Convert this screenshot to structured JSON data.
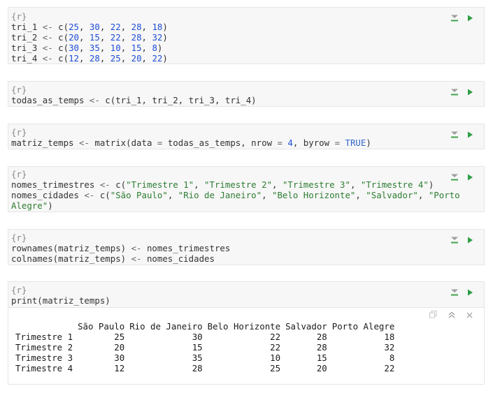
{
  "chunk_header": "{r}",
  "chunks": [
    {
      "lines": [
        [
          [
            "tri_1 ",
            "t"
          ],
          [
            "<- ",
            "op"
          ],
          [
            "c(",
            "t"
          ],
          [
            "25",
            "num"
          ],
          [
            ", ",
            "t"
          ],
          [
            "30",
            "num"
          ],
          [
            ", ",
            "t"
          ],
          [
            "22",
            "num"
          ],
          [
            ", ",
            "t"
          ],
          [
            "28",
            "num"
          ],
          [
            ", ",
            "t"
          ],
          [
            "18",
            "num"
          ],
          [
            ")",
            "t"
          ]
        ],
        [
          [
            "tri_2 ",
            "t"
          ],
          [
            "<- ",
            "op"
          ],
          [
            "c(",
            "t"
          ],
          [
            "20",
            "num"
          ],
          [
            ", ",
            "t"
          ],
          [
            "15",
            "num"
          ],
          [
            ", ",
            "t"
          ],
          [
            "22",
            "num"
          ],
          [
            ", ",
            "t"
          ],
          [
            "28",
            "num"
          ],
          [
            ", ",
            "t"
          ],
          [
            "32",
            "num"
          ],
          [
            ")",
            "t"
          ]
        ],
        [
          [
            "tri_3 ",
            "t"
          ],
          [
            "<- ",
            "op"
          ],
          [
            "c(",
            "t"
          ],
          [
            "30",
            "num"
          ],
          [
            ", ",
            "t"
          ],
          [
            "35",
            "num"
          ],
          [
            ", ",
            "t"
          ],
          [
            "10",
            "num"
          ],
          [
            ", ",
            "t"
          ],
          [
            "15",
            "num"
          ],
          [
            ", ",
            "t"
          ],
          [
            "8",
            "num"
          ],
          [
            ")",
            "t"
          ]
        ],
        [
          [
            "tri_4 ",
            "t"
          ],
          [
            "<- ",
            "op"
          ],
          [
            "c(",
            "t"
          ],
          [
            "12",
            "num"
          ],
          [
            ", ",
            "t"
          ],
          [
            "28",
            "num"
          ],
          [
            ", ",
            "t"
          ],
          [
            "25",
            "num"
          ],
          [
            ", ",
            "t"
          ],
          [
            "20",
            "num"
          ],
          [
            ", ",
            "t"
          ],
          [
            "22",
            "num"
          ],
          [
            ")",
            "t"
          ]
        ]
      ]
    },
    {
      "lines": [
        [
          [
            "todas_as_temps ",
            "t"
          ],
          [
            "<- ",
            "op"
          ],
          [
            "c(tri_1, tri_2, tri_3, tri_4)",
            "t"
          ]
        ]
      ]
    },
    {
      "lines": [
        [
          [
            "matriz_temps ",
            "t"
          ],
          [
            "<- ",
            "op"
          ],
          [
            "matrix(data ",
            "t"
          ],
          [
            "= ",
            "op"
          ],
          [
            "todas_as_temps, nrow ",
            "t"
          ],
          [
            "= ",
            "op"
          ],
          [
            "4",
            "num"
          ],
          [
            ", byrow ",
            "t"
          ],
          [
            "= ",
            "op"
          ],
          [
            "TRUE",
            "kw"
          ],
          [
            ")",
            "t"
          ]
        ]
      ]
    },
    {
      "lines": [
        [
          [
            "nomes_trimestres ",
            "t"
          ],
          [
            "<- ",
            "op"
          ],
          [
            "c(",
            "t"
          ],
          [
            "\"Trimestre 1\"",
            "str"
          ],
          [
            ", ",
            "t"
          ],
          [
            "\"Trimestre 2\"",
            "str"
          ],
          [
            ", ",
            "t"
          ],
          [
            "\"Trimestre 3\"",
            "str"
          ],
          [
            ", ",
            "t"
          ],
          [
            "\"Trimestre 4\"",
            "str"
          ],
          [
            ")",
            "t"
          ]
        ],
        [
          [
            "nomes_cidades ",
            "t"
          ],
          [
            "<- ",
            "op"
          ],
          [
            "c(",
            "t"
          ],
          [
            "\"São Paulo\"",
            "str"
          ],
          [
            ", ",
            "t"
          ],
          [
            "\"Rio de Janeiro\"",
            "str"
          ],
          [
            ", ",
            "t"
          ],
          [
            "\"Belo Horizonte\"",
            "str"
          ],
          [
            ", ",
            "t"
          ],
          [
            "\"Salvador\"",
            "str"
          ],
          [
            ", ",
            "t"
          ],
          [
            "\"Porto",
            "str"
          ]
        ],
        [
          [
            "Alegre\"",
            "str"
          ],
          [
            ")",
            "t"
          ]
        ]
      ]
    },
    {
      "lines": [
        [
          [
            "rownames(matriz_temps) ",
            "t"
          ],
          [
            "<- ",
            "op"
          ],
          [
            "nomes_trimestres",
            "t"
          ]
        ],
        [
          [
            "colnames(matriz_temps) ",
            "t"
          ],
          [
            "<- ",
            "op"
          ],
          [
            "nomes_cidades",
            "t"
          ]
        ]
      ]
    },
    {
      "lines": [
        [
          [
            "print(matriz_temps)",
            "t"
          ]
        ]
      ]
    }
  ],
  "output": {
    "columns": [
      "",
      "São Paulo",
      "Rio de Janeiro",
      "Belo Horizonte",
      "Salvador",
      "Porto Alegre"
    ],
    "rows": [
      [
        "Trimestre 1",
        "25",
        "30",
        "22",
        "28",
        "18"
      ],
      [
        "Trimestre 2",
        "20",
        "15",
        "22",
        "28",
        "32"
      ],
      [
        "Trimestre 3",
        "30",
        "35",
        "10",
        "15",
        "8"
      ],
      [
        "Trimestre 4",
        "12",
        "28",
        "25",
        "20",
        "22"
      ]
    ]
  },
  "icons": {
    "chunk_options": "chunk-options-icon",
    "run_chunk": "run-chunk-icon",
    "output_copy": "copy-output-icon",
    "output_collapse": "collapse-output-icon",
    "output_clear": "clear-output-icon"
  },
  "colors": {
    "run_green": "#2e9e44",
    "options_gray": "#9e9e9e",
    "options_green": "#3fa34d",
    "chunk_bg": "#f7f7f7"
  }
}
